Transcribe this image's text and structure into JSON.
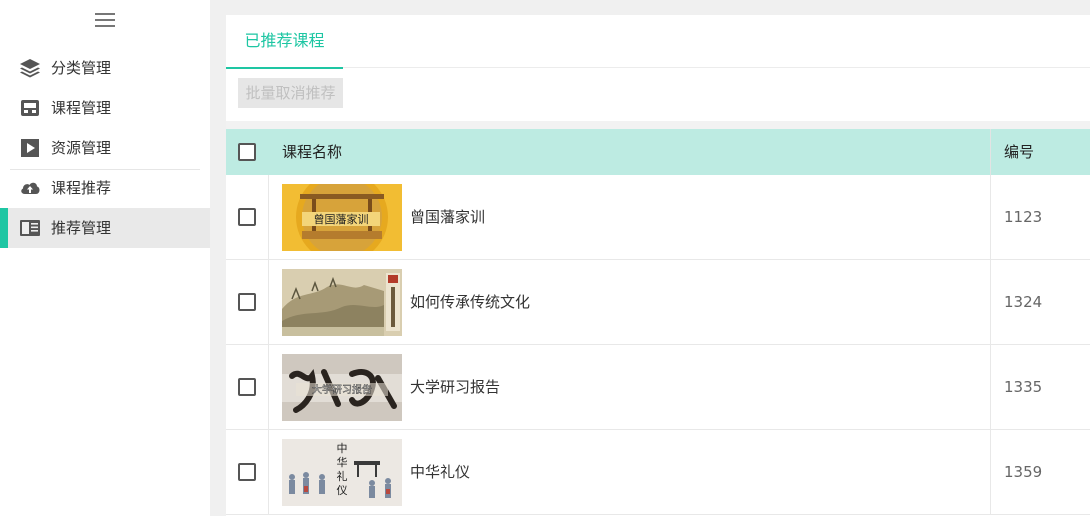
{
  "sidebar": {
    "menu_icon": "hamburger-icon",
    "items": [
      {
        "label": "分类管理",
        "icon": "layers-icon"
      },
      {
        "label": "课程管理",
        "icon": "inbox-icon"
      },
      {
        "label": "资源管理",
        "icon": "play-icon"
      },
      {
        "label": "课程推荐",
        "icon": "cloud-upload-icon"
      },
      {
        "label": "推荐管理",
        "icon": "book-icon",
        "active": true
      }
    ],
    "accent_color": "#1ec6a3"
  },
  "tabs": [
    {
      "label": "已推荐课程",
      "active": true
    }
  ],
  "toolbar": {
    "batch_cancel_label": "批量取消推荐"
  },
  "table": {
    "header_color": "#bdebe2",
    "columns": {
      "name": "课程名称",
      "id": "编号"
    },
    "rows": [
      {
        "name": "曾国藩家训",
        "id": "1123",
        "thumb_text": "曾国藩家训"
      },
      {
        "name": "如何传承传统文化",
        "id": "1324",
        "thumb_text": ""
      },
      {
        "name": "大学研习报告",
        "id": "1335",
        "thumb_text": "大学研习报告"
      },
      {
        "name": "中华礼仪",
        "id": "1359",
        "thumb_text": "中华礼仪"
      }
    ]
  }
}
